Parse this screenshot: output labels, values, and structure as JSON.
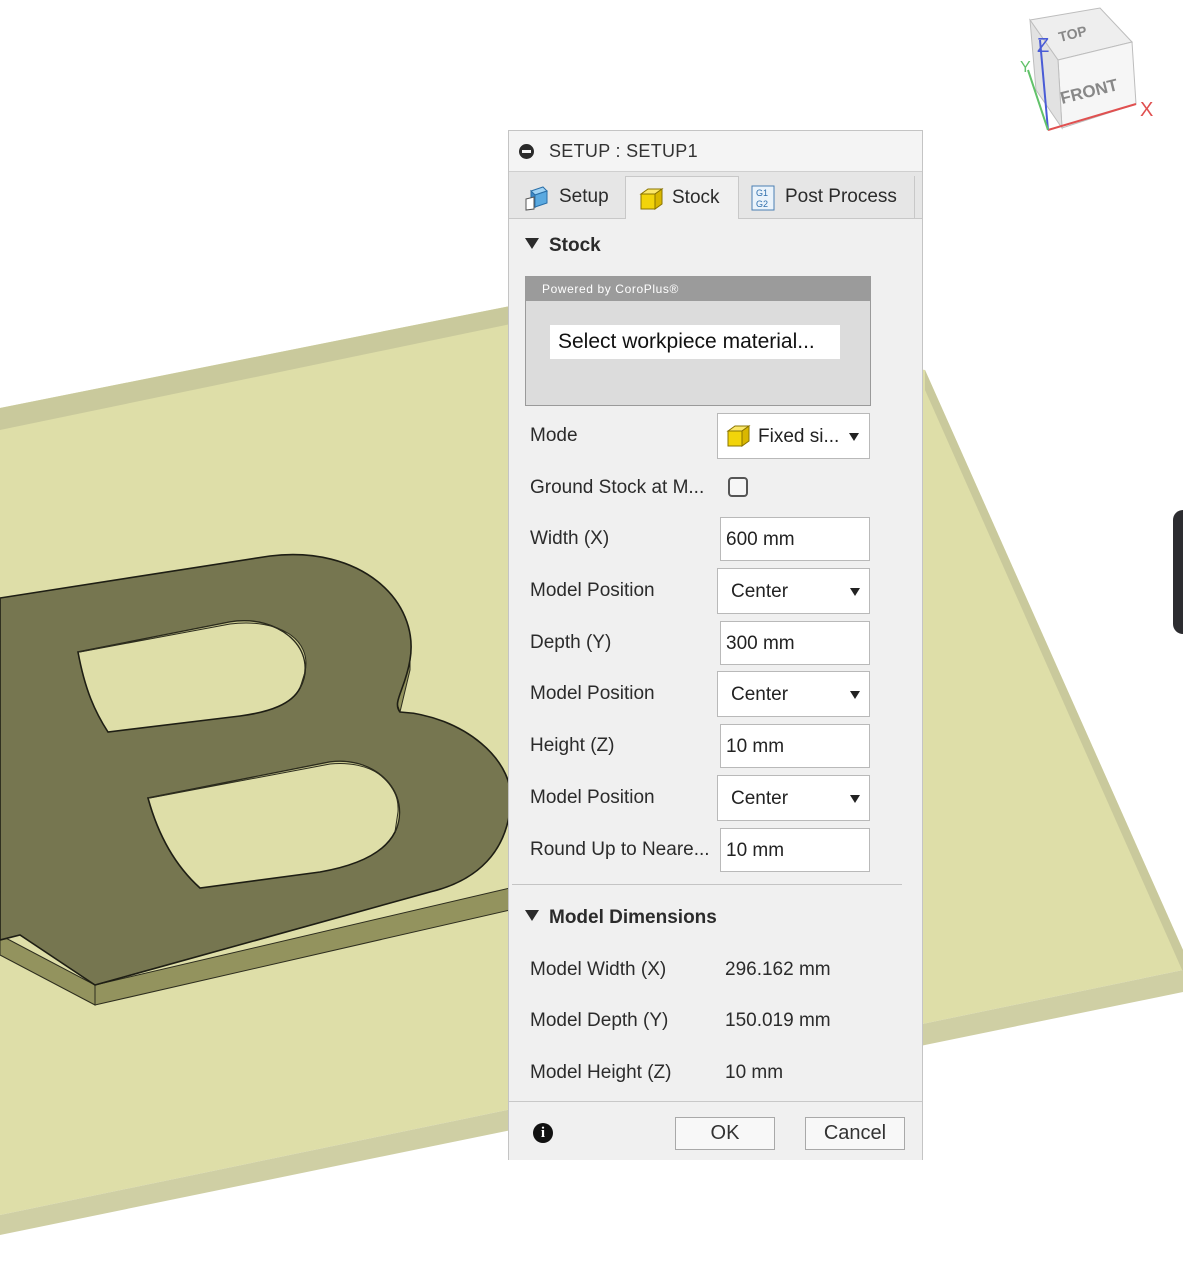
{
  "viewcube": {
    "top": "TOP",
    "front": "FRONT",
    "axis_x": "X",
    "axis_y": "Y",
    "axis_z": "Z"
  },
  "dialog": {
    "title": "SETUP : SETUP1",
    "tabs": [
      {
        "label": "Setup",
        "icon": "setup-icon"
      },
      {
        "label": "Stock",
        "icon": "stock-cube-icon",
        "active": true
      },
      {
        "label": "Post Process",
        "icon": "g1-g2-icon",
        "icon_text_1": "G1",
        "icon_text_2": "G2"
      }
    ],
    "stock_section": {
      "header": "Stock",
      "powered_by": "Powered by CoroPlus®",
      "material_button": "Select workpiece material...",
      "mode": {
        "label": "Mode",
        "value": "Fixed si..."
      },
      "ground_stock": {
        "label": "Ground Stock at M...",
        "checked": false
      },
      "width": {
        "label": "Width (X)",
        "value": "600 mm"
      },
      "width_position": {
        "label": "Model Position",
        "value": "Center"
      },
      "depth": {
        "label": "Depth (Y)",
        "value": "300 mm"
      },
      "depth_position": {
        "label": "Model Position",
        "value": "Center"
      },
      "height": {
        "label": "Height (Z)",
        "value": "10 mm"
      },
      "height_position": {
        "label": "Model Position",
        "value": "Center"
      },
      "round_up": {
        "label": "Round Up to Neare...",
        "value": "10 mm"
      }
    },
    "model_dimensions": {
      "header": "Model Dimensions",
      "width": {
        "label": "Model Width (X)",
        "value": "296.162 mm"
      },
      "depth": {
        "label": "Model Depth (Y)",
        "value": "150.019 mm"
      },
      "height": {
        "label": "Model Height (Z)",
        "value": "10 mm"
      }
    },
    "footer": {
      "info_icon": "i",
      "ok_label": "OK",
      "cancel_label": "Cancel"
    }
  },
  "colors": {
    "stock": "#dedea8",
    "stock_edge": "#c4c498",
    "part_top": "#767650",
    "part_side": "#93935e",
    "dialog_bg": "#f0f0f0",
    "stock_icon": "#f2d40a"
  }
}
